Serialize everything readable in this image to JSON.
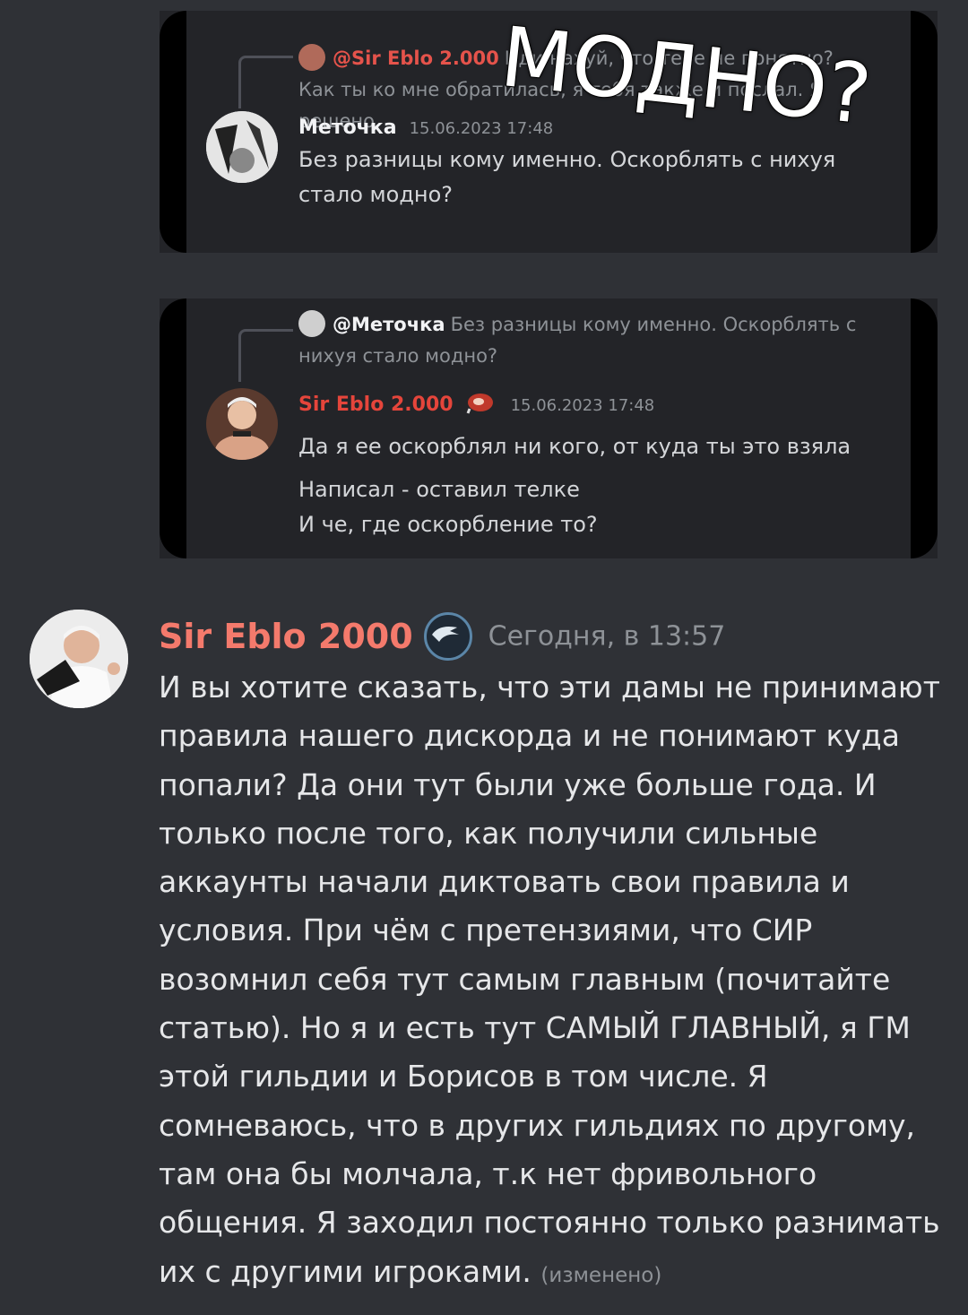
{
  "colors": {
    "background": "#2f3136",
    "embed_bg": "#232428",
    "username_red": "#f47a6c",
    "muted": "#8e9297"
  },
  "embed1": {
    "reply_user": "@Sir Eblo 2.000",
    "reply_text": "Иди нахуй, что тебе не понятно? Как ты ко мне обратилась, я тебя также и послал. Я решено.",
    "author": "Меточка",
    "timestamp": "15.06.2023 17:48",
    "text_line1": "Без разницы кому именно. Оскорблять с нихуя",
    "text_line2": "стало модно?"
  },
  "overlay_text": "МОДНО?",
  "embed2": {
    "reply_user": "@Меточка",
    "reply_text": "Без разницы кому именно. Оскорблять с нихуя стало модно?",
    "author": "Sir Eblo 2.000",
    "timestamp": "15.06.2023 17:48",
    "line1": "Да я ее оскорблял ни кого, от куда ты это взяла",
    "line2": "Написал - оставил телке",
    "line3": "И че, где оскорбление то?"
  },
  "main_message": {
    "author": "Sir Eblo 2000",
    "timestamp": "Сегодня, в 13:57",
    "text": "И вы хотите сказать, что эти дамы не принимают правила нашего дискорда и не понимают куда попали? Да они тут были уже больше года. И только после того, как получили сильные аккаунты начали диктовать свои правила и условия. При чём с претензиями, что СИР возомнил себя тут самым главным (почитайте статью). Но я и есть тут САМЫЙ ГЛАВНЫЙ, я ГМ этой гильдии и Борисов в том числе. Я сомневаюсь, что в других гильдиях по другому, там она бы молчала, т.к нет фривольного общения. Я заходил постоянно только разнимать их с другими игроками.",
    "edited": "(изменено)"
  }
}
